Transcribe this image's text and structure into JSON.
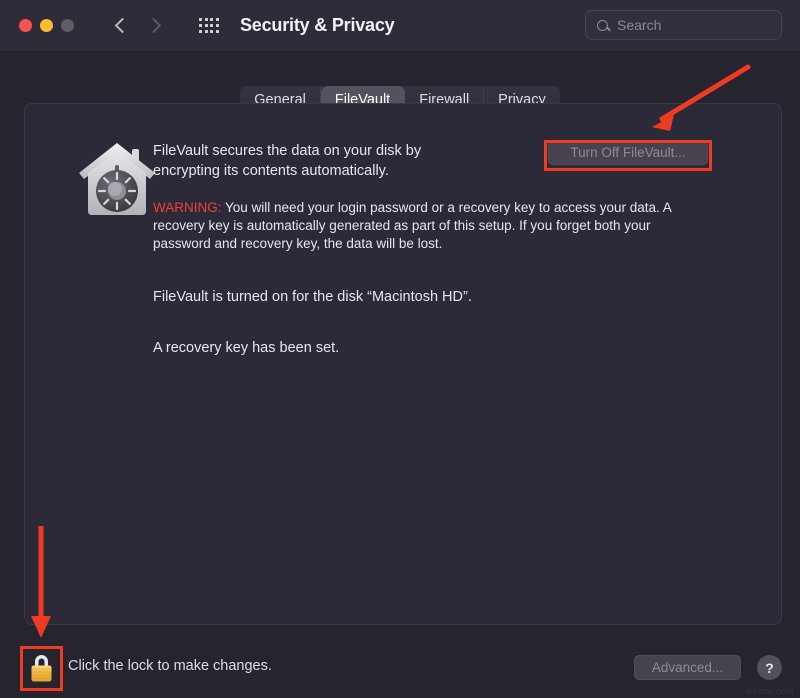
{
  "window": {
    "title": "Security & Privacy",
    "traffic_lights": [
      "close-red",
      "minimize-yellow",
      "zoom-gray"
    ],
    "nav": {
      "back": "back-chevron",
      "forward": "forward-chevron"
    },
    "show_all_icon": "grid-icon",
    "background_color": "#26242f",
    "titlebar_color": "#2e2c38"
  },
  "search": {
    "placeholder": "Search",
    "icon": "search-icon",
    "value": ""
  },
  "tabs": [
    {
      "label": "General",
      "active": false
    },
    {
      "label": "FileVault",
      "active": true
    },
    {
      "label": "Firewall",
      "active": false
    },
    {
      "label": "Privacy",
      "active": false
    }
  ],
  "panel": {
    "icon": "filevault-house-safe-icon",
    "description_line1": "FileVault secures the data on your disk by",
    "description_line2": "encrypting its contents automatically.",
    "warning_label": "WARNING:",
    "warning_text": "You will need your login password or a recovery key to access your data. A recovery key is automatically generated as part of this setup. If you forget both your password and recovery key, the data will be lost.",
    "status_text": "FileVault is turned on for the disk “Macintosh HD”.",
    "recovery_text": "A recovery key has been set.",
    "turn_off_button": "Turn Off FileVault...",
    "turn_off_enabled": false,
    "background_color": "#2c2a38"
  },
  "bottom": {
    "lock_icon": "padlock-closed-icon",
    "lock_state": "locked",
    "lock_text": "Click the lock to make changes.",
    "advanced_button": "Advanced...",
    "advanced_enabled": false,
    "help_button": "?"
  },
  "annotations": {
    "color": "#ee3b21",
    "box_turn_off": "highlight-box-turn-off-filevault",
    "box_lock": "highlight-box-lock",
    "arrow_turn_off": "arrow-pointing-to-turn-off-filevault",
    "arrow_lock": "arrow-pointing-to-lock"
  },
  "watermark": "wsxdn.com"
}
